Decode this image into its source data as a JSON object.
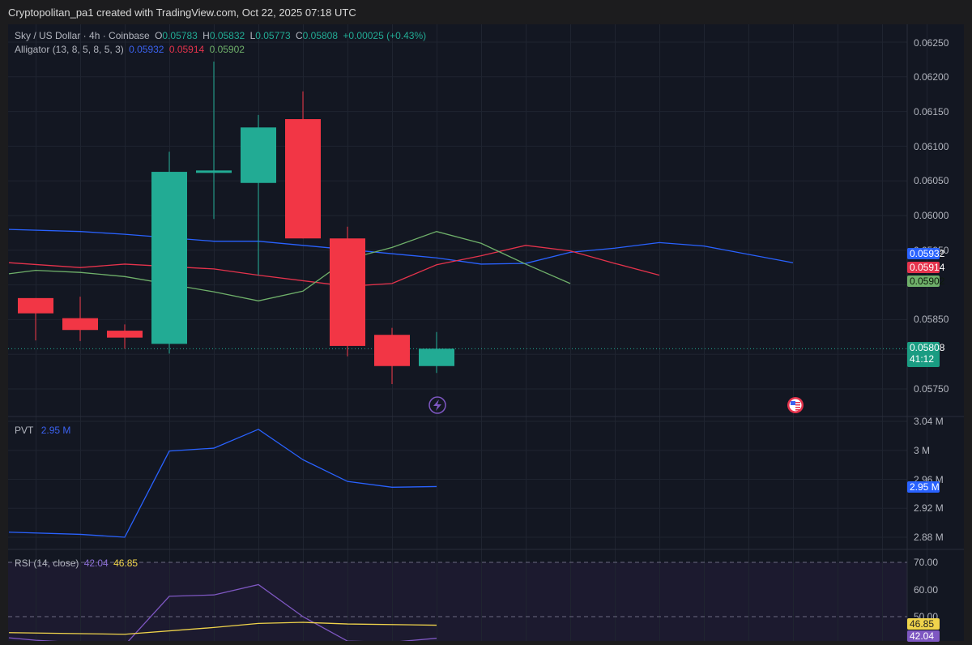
{
  "caption": "Cryptopolitan_pa1 created with TradingView.com, Oct 22, 2025 07:18 UTC",
  "symbol": {
    "title": "Sky / US Dollar · 4h · Coinbase",
    "o_label": "O",
    "o": "0.05783",
    "h_label": "H",
    "h": "0.05832",
    "l_label": "L",
    "l": "0.05773",
    "c_label": "C",
    "c": "0.05808",
    "change": "+0.00025 (+0.43%)"
  },
  "alligator": {
    "label": "Alligator (13, 8, 5, 8, 5, 3)",
    "jaw": "0.05932",
    "teeth": "0.05914",
    "lips": "0.05902"
  },
  "pvt": {
    "label": "PVT",
    "value": "2.95 M"
  },
  "rsi": {
    "label": "RSI (14, close)",
    "value": "42.04",
    "ma": "46.85"
  },
  "price_axis": [
    "0.06250",
    "0.06200",
    "0.06150",
    "0.06100",
    "0.06050",
    "0.06000",
    "0.05950",
    "0.05850",
    "0.05750"
  ],
  "price_tags": {
    "jaw": "0.05932",
    "teeth": "0.05914",
    "lips": "0.05902",
    "last": "0.05808",
    "countdown": "41:12"
  },
  "pvt_axis": [
    "3.04 M",
    "3 M",
    "2.96 M",
    "2.92 M",
    "2.88 M"
  ],
  "pvt_tag": "2.95 M",
  "rsi_axis": [
    "70.00",
    "60.00",
    "50.00"
  ],
  "rsi_tags": {
    "ma": "46.85",
    "rsi": "42.04"
  },
  "colors": {
    "up": "#22ab94",
    "down": "#f23645",
    "jaw": "#2962ff",
    "teeth": "#e5334c",
    "lips": "#6fb06a",
    "pvt": "#2962ff",
    "rsi": "#7e57c2",
    "rsi_ma": "#f0d44b",
    "bg": "#131722"
  },
  "chart_data": {
    "type": "candlestick",
    "candles": [
      {
        "o": 0.05881,
        "h": 0.05881,
        "l": 0.0582,
        "c": 0.05859
      },
      {
        "o": 0.05852,
        "h": 0.05883,
        "l": 0.05819,
        "c": 0.05835
      },
      {
        "o": 0.05834,
        "h": 0.05843,
        "l": 0.05808,
        "c": 0.05824
      },
      {
        "o": 0.05815,
        "h": 0.06092,
        "l": 0.05801,
        "c": 0.06063
      },
      {
        "o": 0.06062,
        "h": 0.06222,
        "l": 0.05995,
        "c": 0.06065
      },
      {
        "o": 0.06047,
        "h": 0.06145,
        "l": 0.05914,
        "c": 0.06127
      },
      {
        "o": 0.06139,
        "h": 0.06179,
        "l": 0.05967,
        "c": 0.05967
      },
      {
        "o": 0.05967,
        "h": 0.05984,
        "l": 0.05797,
        "c": 0.05812
      },
      {
        "o": 0.05828,
        "h": 0.05838,
        "l": 0.05757,
        "c": 0.05783
      },
      {
        "o": 0.05783,
        "h": 0.05832,
        "l": 0.05773,
        "c": 0.05808
      }
    ],
    "price_range": [
      0.0572,
      0.0628
    ],
    "jaw": [
      [
        -0.6,
        0.0598
      ],
      [
        1,
        0.05977
      ],
      [
        2,
        0.05973
      ],
      [
        4,
        0.05963
      ],
      [
        5,
        0.05963
      ],
      [
        7,
        0.05951
      ],
      [
        9,
        0.05939
      ],
      [
        10,
        0.0593
      ],
      [
        11,
        0.05931
      ],
      [
        12,
        0.05947
      ],
      [
        13,
        0.05953
      ],
      [
        14,
        0.05961
      ],
      [
        15,
        0.05956
      ],
      [
        17,
        0.05932
      ]
    ],
    "teeth": [
      [
        -0.6,
        0.05932
      ],
      [
        1,
        0.05925
      ],
      [
        2,
        0.0593
      ],
      [
        4,
        0.05923
      ],
      [
        5,
        0.05914
      ],
      [
        7,
        0.05898
      ],
      [
        8,
        0.05902
      ],
      [
        9,
        0.05929
      ],
      [
        10,
        0.05942
      ],
      [
        11,
        0.05957
      ],
      [
        12,
        0.05949
      ],
      [
        13,
        0.05931
      ],
      [
        14,
        0.05914
      ]
    ],
    "lips": [
      [
        -0.6,
        0.05916
      ],
      [
        0,
        0.05921
      ],
      [
        1,
        0.05918
      ],
      [
        2,
        0.05912
      ],
      [
        4,
        0.0589
      ],
      [
        5,
        0.05877
      ],
      [
        6,
        0.05891
      ],
      [
        7,
        0.05937
      ],
      [
        8,
        0.05954
      ],
      [
        9,
        0.05977
      ],
      [
        10,
        0.0596
      ],
      [
        11,
        0.0593
      ],
      [
        12,
        0.05902
      ]
    ],
    "pvt": [
      [
        -0.6,
        2.887
      ],
      [
        1,
        2.884
      ],
      [
        2,
        2.88
      ],
      [
        3,
        2.999
      ],
      [
        4,
        3.003
      ],
      [
        5,
        3.029
      ],
      [
        6,
        2.987
      ],
      [
        7,
        2.957
      ],
      [
        8,
        2.949
      ],
      [
        9,
        2.95
      ]
    ],
    "rsi": [
      [
        -0.6,
        42.2
      ],
      [
        0,
        41.3
      ],
      [
        2,
        39.5
      ],
      [
        3,
        57.5
      ],
      [
        4,
        58.0
      ],
      [
        5,
        61.8
      ],
      [
        6,
        50.0
      ],
      [
        7,
        41.0
      ],
      [
        8,
        40.6
      ],
      [
        9,
        42.04
      ]
    ],
    "rsi_ma": [
      [
        -0.6,
        44.1
      ],
      [
        2,
        43.5
      ],
      [
        4,
        46.0
      ],
      [
        5,
        47.5
      ],
      [
        6,
        47.9
      ],
      [
        7,
        47.3
      ],
      [
        9,
        46.85
      ]
    ]
  }
}
